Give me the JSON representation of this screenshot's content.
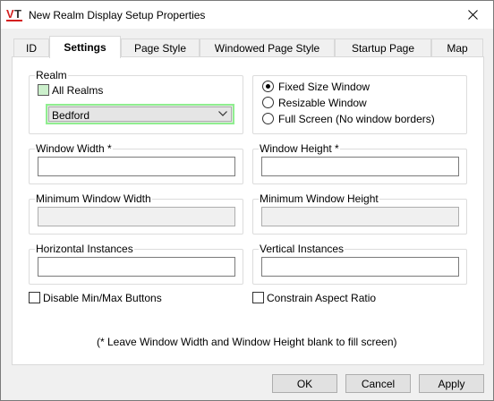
{
  "window": {
    "title": "New Realm Display Setup Properties",
    "logo_text": "VT"
  },
  "tabs": [
    {
      "label": "ID"
    },
    {
      "label": "Settings"
    },
    {
      "label": "Page Style"
    },
    {
      "label": "Windowed Page Style"
    },
    {
      "label": "Startup Page"
    },
    {
      "label": "Map"
    }
  ],
  "realm": {
    "group_label": "Realm",
    "all_realms_label": "All Realms",
    "selected": "Bedford"
  },
  "window_mode": {
    "options": [
      "Fixed Size Window",
      "Resizable Window",
      "Full Screen (No window borders)"
    ],
    "selected_index": 0
  },
  "fields": {
    "window_width_label": "Window Width *",
    "window_height_label": "Window Height *",
    "min_width_label": "Minimum Window Width",
    "min_height_label": "Minimum Window Height",
    "horizontal_instances_label": "Horizontal Instances",
    "vertical_instances_label": "Vertical Instances"
  },
  "options": {
    "disable_minmax_label": "Disable Min/Max Buttons",
    "constrain_aspect_label": "Constrain Aspect Ratio"
  },
  "note": "(* Leave Window Width and Window Height blank to fill screen)",
  "buttons": {
    "ok": "OK",
    "cancel": "Cancel",
    "apply": "Apply"
  },
  "colors": {
    "logo_red": "#d42020",
    "highlight_green": "#90ee90"
  }
}
